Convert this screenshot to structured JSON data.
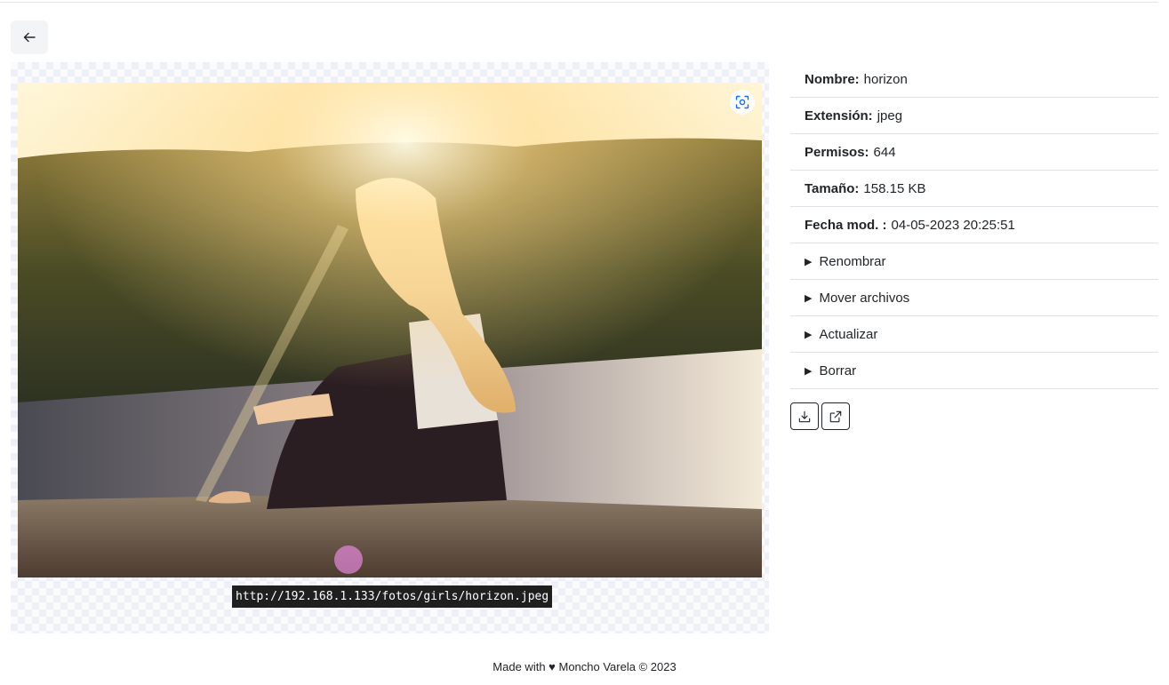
{
  "header": {
    "back_icon": "arrow-left-icon"
  },
  "viewer": {
    "fullscreen_icon": "focus-icon",
    "url": "http://192.168.1.133/fotos/girls/horizon.jpeg"
  },
  "info": {
    "name_label": "Nombre:",
    "name_value": "horizon",
    "ext_label": "Extensión:",
    "ext_value": "jpeg",
    "perm_label": "Permisos:",
    "perm_value": "644",
    "size_label": "Tamaño:",
    "size_value": "158.15 KB",
    "date_label": "Fecha mod. :",
    "date_value": "04-05-2023 20:25:51",
    "details": [
      {
        "marker": "▶",
        "label": "Renombrar"
      },
      {
        "marker": "▶",
        "label": "Mover archivos"
      },
      {
        "marker": "▶",
        "label": "Actualizar"
      },
      {
        "marker": "▶",
        "label": "Borrar"
      }
    ]
  },
  "actions": {
    "download_icon": "download-icon",
    "open_icon": "external-link-icon"
  },
  "footer": {
    "text": "Made with ♥ Moncho Varela © 2023"
  }
}
